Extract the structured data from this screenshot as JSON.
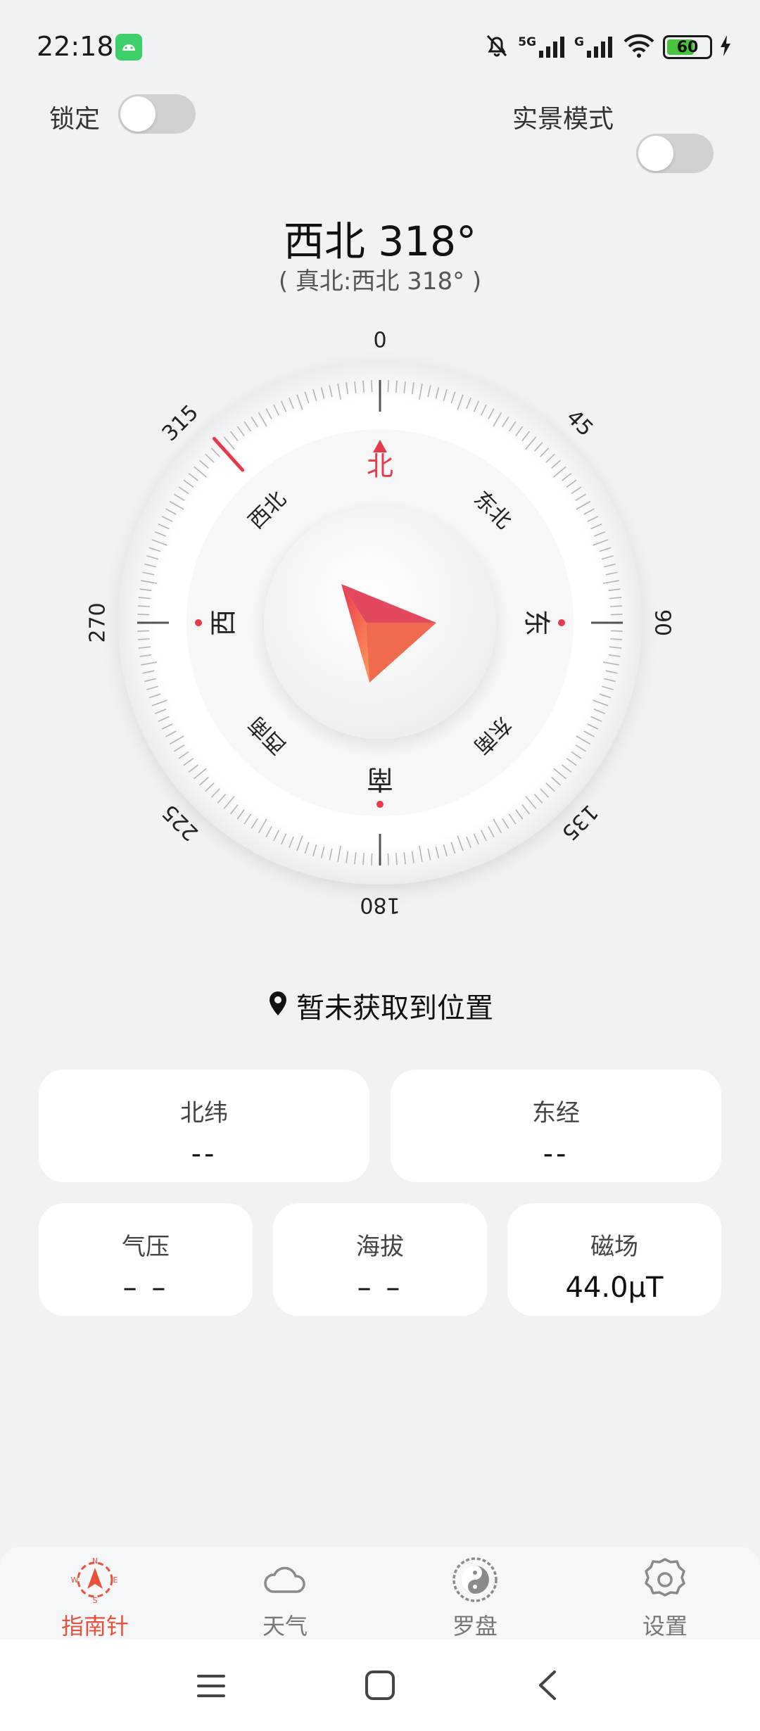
{
  "status_bar": {
    "time": "22:18",
    "network_label_1": "5G",
    "network_label_2": "G",
    "battery": "60"
  },
  "toggles": {
    "lock_label": "锁定",
    "lock_on": false,
    "live_label": "实景模式",
    "live_on": false
  },
  "heading": {
    "main": "西北 318°",
    "sub": "( 真北:西北 318° )",
    "degrees": 318
  },
  "compass": {
    "degree_labels": [
      "0",
      "45",
      "90",
      "135",
      "180",
      "225",
      "270",
      "315"
    ],
    "cardinal": {
      "north": "北",
      "east": "东",
      "south": "南",
      "west": "西"
    },
    "intercardinal": {
      "ne": "东北",
      "se": "东南",
      "sw": "西南",
      "nw": "西北"
    },
    "accent_color": "#e8394a"
  },
  "location": {
    "text": "暂未获取到位置"
  },
  "cards": {
    "latitude": {
      "label": "北纬",
      "value": "--"
    },
    "longitude": {
      "label": "东经",
      "value": "--"
    },
    "pressure": {
      "label": "气压",
      "value": "– –"
    },
    "altitude": {
      "label": "海拔",
      "value": "– –"
    },
    "magnetic": {
      "label": "磁场",
      "value": "44.0μT"
    }
  },
  "bottom_nav": {
    "compass": "指南针",
    "weather": "天气",
    "luopan": "罗盘",
    "settings": "设置"
  }
}
